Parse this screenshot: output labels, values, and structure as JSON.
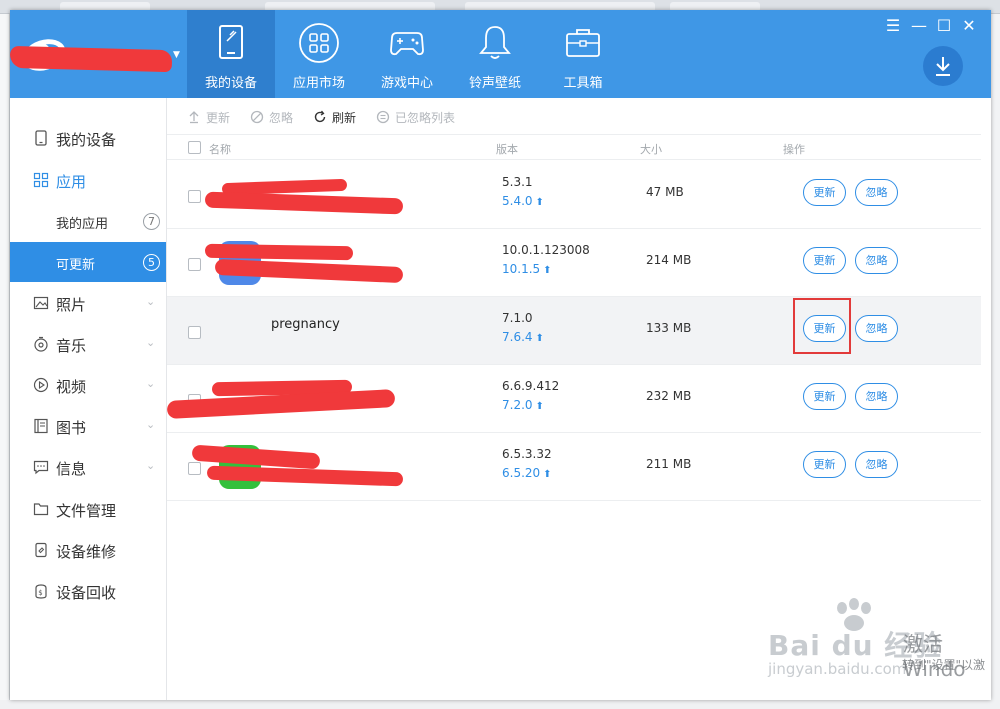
{
  "header": {
    "nav": [
      {
        "id": "my-device",
        "label": "我的设备",
        "icon": "tablet-icon",
        "active": true
      },
      {
        "id": "app-market",
        "label": "应用市场",
        "icon": "grid-icon",
        "active": false
      },
      {
        "id": "game-center",
        "label": "游戏中心",
        "icon": "gamepad-icon",
        "active": false
      },
      {
        "id": "ringtones",
        "label": "铃声壁纸",
        "icon": "bell-icon",
        "active": false
      },
      {
        "id": "toolbox",
        "label": "工具箱",
        "icon": "toolbox-icon",
        "active": false
      }
    ],
    "window_controls": [
      "☰",
      "—",
      "☐",
      "✕"
    ]
  },
  "sidebar": {
    "items": [
      {
        "label": "我的设备",
        "icon": "phone-icon"
      },
      {
        "label": "应用",
        "icon": "apps-icon"
      },
      {
        "label": "我的应用",
        "badge": "7"
      },
      {
        "label": "可更新",
        "badge": "5"
      },
      {
        "label": "照片",
        "icon": "photo-icon"
      },
      {
        "label": "音乐",
        "icon": "music-icon"
      },
      {
        "label": "视频",
        "icon": "video-icon"
      },
      {
        "label": "图书",
        "icon": "book-icon"
      },
      {
        "label": "信息",
        "icon": "message-icon"
      },
      {
        "label": "文件管理",
        "icon": "folder-icon"
      },
      {
        "label": "设备维修",
        "icon": "repair-icon"
      },
      {
        "label": "设备回收",
        "icon": "recycle-icon"
      }
    ]
  },
  "toolbar": {
    "update": "更新",
    "ignore": "忽略",
    "refresh": "刷新",
    "ignored_list": "已忽略列表"
  },
  "table": {
    "columns": {
      "name": "名称",
      "version": "版本",
      "size": "大小",
      "action": "操作"
    },
    "action_update": "更新",
    "action_ignore": "忽略",
    "rows": [
      {
        "name": "",
        "version": "5.3.1",
        "new_version": "5.4.0",
        "size": "47 MB"
      },
      {
        "name": "",
        "version": "10.0.1.123008",
        "new_version": "10.1.5",
        "size": "214 MB"
      },
      {
        "name": "pregnancy",
        "version": "7.1.0",
        "new_version": "7.6.4",
        "size": "133 MB"
      },
      {
        "name": "",
        "version": "6.6.9.412",
        "new_version": "7.2.0",
        "size": "232 MB"
      },
      {
        "name": "",
        "version": "6.5.3.32",
        "new_version": "6.5.20",
        "size": "211 MB"
      }
    ]
  },
  "watermark": {
    "brand": "Bai  du 经验",
    "site": "jingyan.baidu.com",
    "activation_title": "激活 Windo",
    "activation_sub": "转到\"设置\"以激"
  },
  "colors": {
    "header_blue": "#3f97e6",
    "active_blue": "#2f7fce",
    "accent": "#2f8ee5",
    "highlight_red": "#e23a3a"
  }
}
